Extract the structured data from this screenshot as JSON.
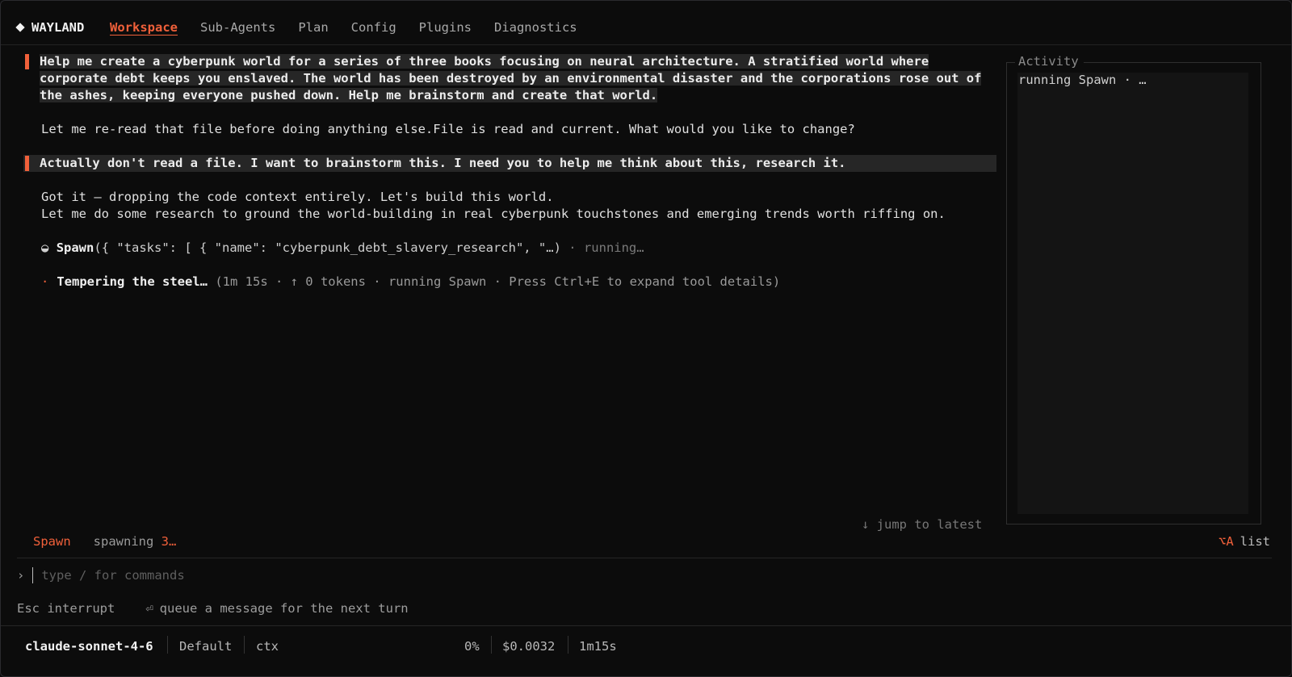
{
  "brand": "WAYLAND",
  "nav": [
    {
      "label": "Workspace",
      "active": true
    },
    {
      "label": "Sub-Agents",
      "active": false
    },
    {
      "label": "Plan",
      "active": false
    },
    {
      "label": "Config",
      "active": false
    },
    {
      "label": "Plugins",
      "active": false
    },
    {
      "label": "Diagnostics",
      "active": false
    }
  ],
  "chat": {
    "user1": "Help me create a cyberpunk world for a series of three books focusing on neural architecture. A stratified world where corporate debt keeps you enslaved. The world has been destroyed by an environmental disaster and the corporations rose out of the ashes, keeping everyone pushed down. Help me brainstorm and create that world.",
    "assistant1": "Let me re-read that file before doing anything else.File is read and current. What would you like to change?",
    "user2": "Actually don't read a file. I want to brainstorm this. I need you to help me think about this, research it.",
    "assistant2": "Got it — dropping the code context entirely. Let's build this world.\nLet me do some research to ground the world-building in real cyberpunk touchstones and emerging trends worth riffing on.",
    "tool_name": "Spawn",
    "tool_args": "({ \"tasks\": [ { \"name\": \"cyberpunk_debt_slavery_research\", \"…)",
    "tool_status": "· running…",
    "status_title": "Tempering the steel…",
    "status_detail": "(1m 15s · ↑ 0 tokens · running Spawn · Press Ctrl+E to expand tool details)"
  },
  "activity": {
    "label": "Activity",
    "line": "running Spawn · …"
  },
  "jump_label": "↓ jump to latest",
  "spawn_row": {
    "name": "Spawn",
    "status_prefix": "spawning ",
    "count": "3…"
  },
  "list_hint": {
    "key": "⌥A",
    "label": "list"
  },
  "prompt": {
    "caret": "›",
    "placeholder": "type / for commands"
  },
  "hints": {
    "interrupt": "Esc interrupt",
    "enter_symbol": "⏎",
    "queue": "queue a message for the next turn"
  },
  "footer": {
    "model": "claude-sonnet-4-6",
    "mode": "Default",
    "ctx_label": "ctx",
    "ctx_pct": "0%",
    "cost": "$0.0032",
    "elapsed": "1m15s"
  },
  "colors": {
    "accent": "#f0603a",
    "background": "#0c0c0c"
  }
}
